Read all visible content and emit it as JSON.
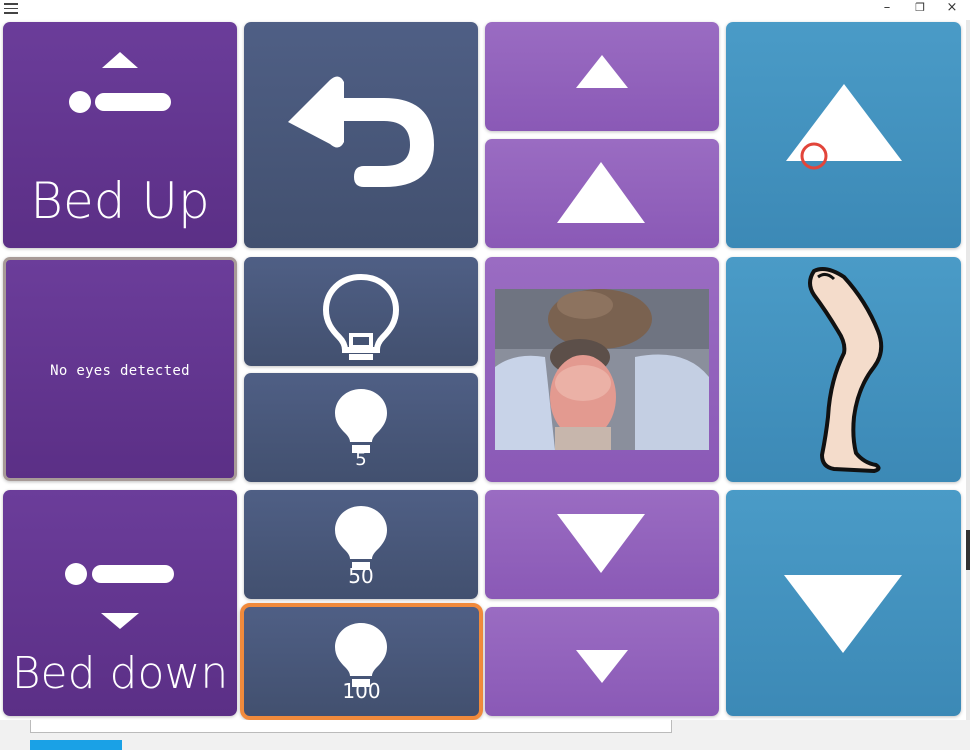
{
  "window": {
    "minimize": "–",
    "maximize": "❐",
    "close": "×"
  },
  "tiles": {
    "bed_up": {
      "label": "Bed Up"
    },
    "bed_down": {
      "label": "Bed down"
    },
    "eye_status": {
      "text": "No eyes detected"
    },
    "light_5": {
      "value": "5"
    },
    "light_50": {
      "value": "50"
    },
    "light_100": {
      "value": "100"
    }
  },
  "colors": {
    "purple_dark": "#5f3290",
    "slate": "#48577a",
    "purple_light": "#925fbc",
    "blue": "#4191be",
    "selection_border": "#f08a3c",
    "gaze_marker": "#e2453a"
  },
  "icons": {
    "back": "back-arrow-icon",
    "lightbulb": "lightbulb-icon",
    "leg": "leg-icon",
    "up": "triangle-up-icon",
    "down": "triangle-down-icon"
  }
}
